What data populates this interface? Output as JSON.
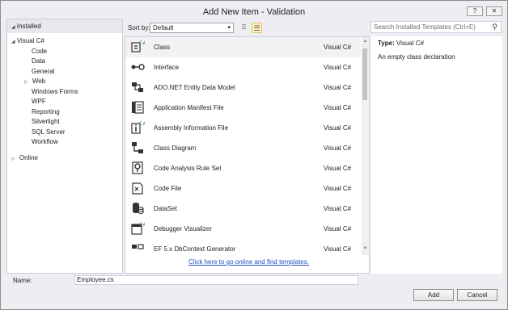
{
  "window": {
    "title": "Add New Item - Validation",
    "help_label": "?",
    "close_label": "✕"
  },
  "left": {
    "header": "Installed",
    "tree": [
      {
        "label": "Visual C#",
        "expander": "◢",
        "selected": true
      },
      {
        "label": "Code"
      },
      {
        "label": "Data"
      },
      {
        "label": "General"
      },
      {
        "label": "Web",
        "expander": "▷"
      },
      {
        "label": "Windows Forms"
      },
      {
        "label": "WPF"
      },
      {
        "label": "Reporting"
      },
      {
        "label": "Silverlight"
      },
      {
        "label": "SQL Server"
      },
      {
        "label": "Workflow"
      }
    ],
    "online": {
      "label": "Online",
      "expander": "▷"
    }
  },
  "toolbar": {
    "sort_label": "Sort by:",
    "sort_value": "Default",
    "chevron": "▾",
    "small_icons": "⠿",
    "list_icons": "☰"
  },
  "templates": [
    {
      "name": "Class",
      "language": "Visual C#",
      "icon": "class-icon",
      "selected": true
    },
    {
      "name": "Interface",
      "language": "Visual C#",
      "icon": "interface-icon"
    },
    {
      "name": "ADO.NET Entity Data Model",
      "language": "Visual C#",
      "icon": "entity-model-icon"
    },
    {
      "name": "Application Manifest File",
      "language": "Visual C#",
      "icon": "manifest-icon"
    },
    {
      "name": "Assembly Information File",
      "language": "Visual C#",
      "icon": "assembly-info-icon"
    },
    {
      "name": "Class Diagram",
      "language": "Visual C#",
      "icon": "class-diagram-icon"
    },
    {
      "name": "Code Analysis Rule Set",
      "language": "Visual C#",
      "icon": "rule-set-icon"
    },
    {
      "name": "Code File",
      "language": "Visual C#",
      "icon": "code-file-icon"
    },
    {
      "name": "DataSet",
      "language": "Visual C#",
      "icon": "dataset-icon"
    },
    {
      "name": "Debugger Visualizer",
      "language": "Visual C#",
      "icon": "debugger-visualizer-icon"
    },
    {
      "name": "EF 5.x DbContext Generator",
      "language": "Visual C#",
      "icon": "ef-generator-icon"
    }
  ],
  "online_link": "Click here to go online and find templates.",
  "search": {
    "placeholder": "Search Installed Templates (Ctrl+E)",
    "icon": "⚲"
  },
  "details": {
    "type_label": "Type:",
    "type_value": "Visual C#",
    "description": "An empty class declaration"
  },
  "name_field": {
    "label": "Name:",
    "value": "Employee.cs"
  },
  "buttons": {
    "add": "Add",
    "cancel": "Cancel"
  },
  "colors": {
    "accent": "#68217a",
    "selection": "#cce8ff",
    "link": "#1e50c8"
  }
}
